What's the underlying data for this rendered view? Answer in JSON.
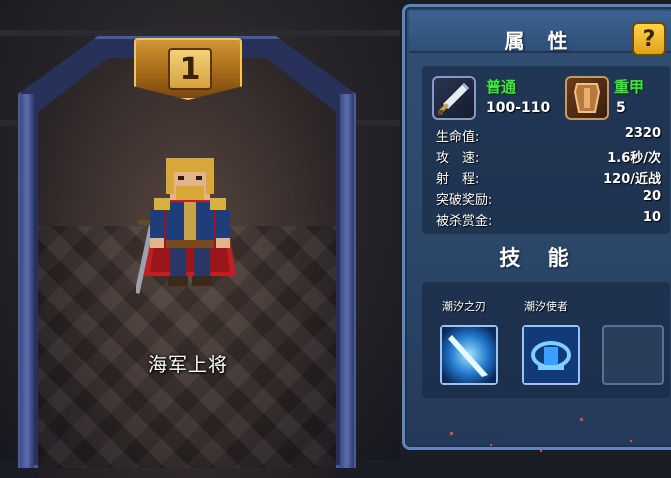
{
  "hero": {
    "rank": "1",
    "name": "海军上将"
  },
  "attributes": {
    "title": "属 性",
    "help_label": "?",
    "attack": {
      "type": "普通",
      "value": "100-110",
      "icon": "sword-icon"
    },
    "armor": {
      "type": "重甲",
      "value": "5",
      "icon": "shield-icon"
    },
    "rows": [
      {
        "label": "生命值:",
        "value": "2320"
      },
      {
        "label": "攻　速:",
        "value": "1.6秒/次"
      },
      {
        "label": "射　程:",
        "value": "120/近战"
      },
      {
        "label": "突破奖励:",
        "value": "20"
      },
      {
        "label": "被杀赏金:",
        "value": "10"
      }
    ]
  },
  "skills": {
    "title": "技 能",
    "items": [
      {
        "name": "潮汐之刃",
        "icon": "tidal-blade-icon"
      },
      {
        "name": "潮汐使者",
        "icon": "tide-messenger-icon"
      },
      {
        "name": "",
        "icon": "empty-slot"
      }
    ]
  },
  "colors": {
    "type_green": "#3fe83a",
    "gold": "#d09634",
    "panel_blue": "#2b4566",
    "frame_blue": "#4a5b98"
  }
}
